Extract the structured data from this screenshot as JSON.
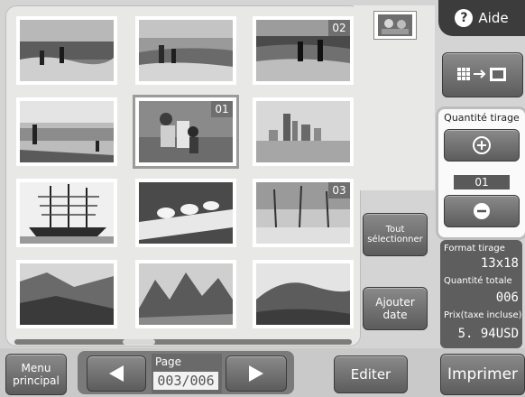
{
  "help": {
    "label": "Aide",
    "icon": "question-icon"
  },
  "photos": [
    {
      "badge": ""
    },
    {
      "badge": ""
    },
    {
      "badge": "02"
    },
    {
      "badge": ""
    },
    {
      "badge": "01"
    },
    {
      "badge": ""
    },
    {
      "badge": ""
    },
    {
      "badge": ""
    },
    {
      "badge": "03"
    },
    {
      "badge": ""
    },
    {
      "badge": ""
    },
    {
      "badge": ""
    }
  ],
  "select_all": {
    "line1": "Tout",
    "line2": "sélectionner"
  },
  "add_date": {
    "line1": "Ajouter",
    "line2": "date"
  },
  "quantity": {
    "title": "Quantité tirage",
    "value": "01"
  },
  "info": {
    "format_label": "Format tirage",
    "format_value": "13x18",
    "total_label": "Quantité totale",
    "total_value": "006",
    "price_label": "Prix(taxe incluse)",
    "price_value": "5. 94USD"
  },
  "bottom": {
    "menu_line1": "Menu",
    "menu_line2": "principal",
    "page_label": "Page",
    "page_value": "003/006",
    "edit": "Editer",
    "print": "Imprimer"
  },
  "colors": {
    "panel": "#e8e8e6",
    "button_dark": "#5c5c5c",
    "info_bg": "#5e5e5e"
  }
}
